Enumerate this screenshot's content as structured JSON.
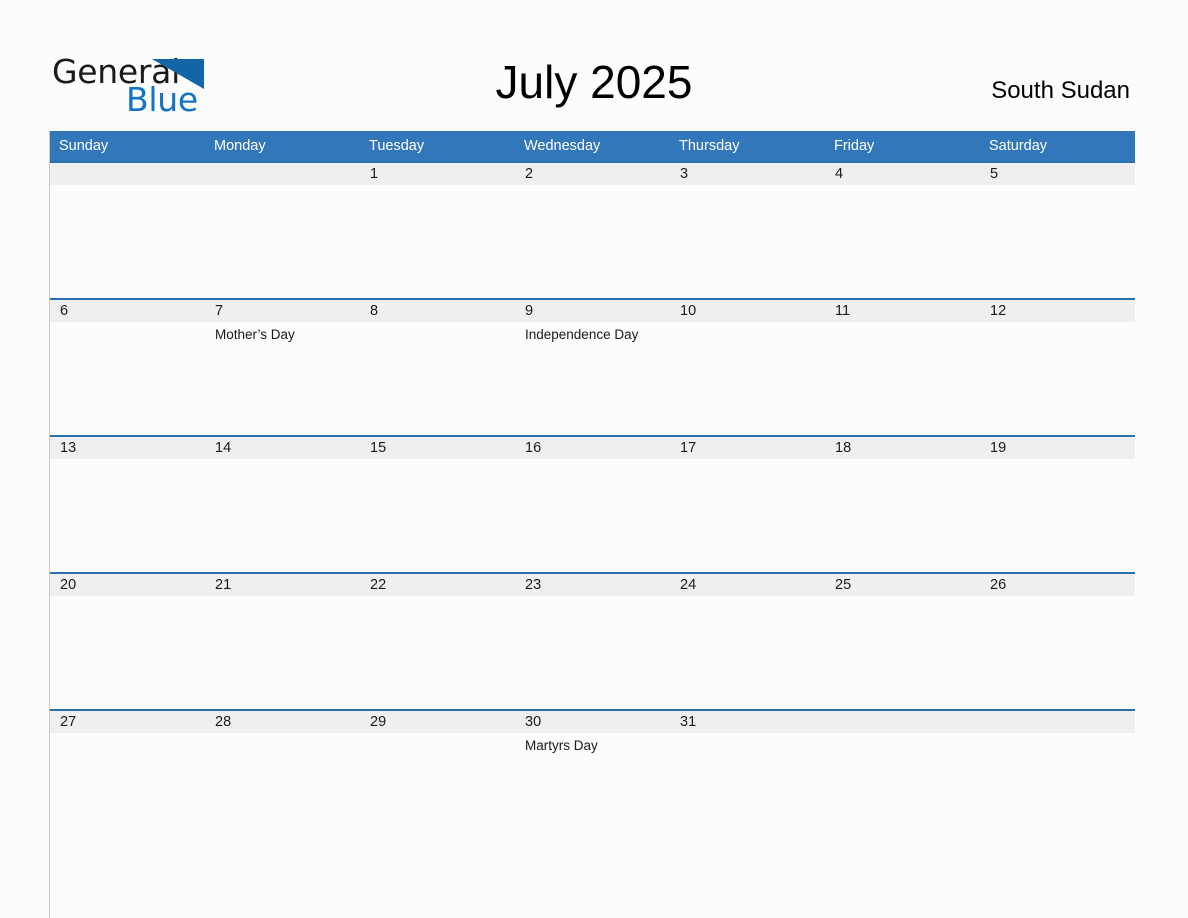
{
  "brand": {
    "name_part1": "General",
    "name_part2": "Blue",
    "triangle_icon": "brand-triangle-icon",
    "color_black": "#1A1A1A",
    "color_blue": "#1473C4"
  },
  "header": {
    "title": "July 2025",
    "country": "South Sudan"
  },
  "colors": {
    "header_blue": "#3177B9",
    "row_separator_blue": "#2C6FAF",
    "daynum_band": "#EFEFEF",
    "cell_background": "#FCFCFC"
  },
  "weekdays": [
    "Sunday",
    "Monday",
    "Tuesday",
    "Wednesday",
    "Thursday",
    "Friday",
    "Saturday"
  ],
  "weeks": [
    {
      "days": [
        {
          "num": "",
          "events": []
        },
        {
          "num": "",
          "events": []
        },
        {
          "num": "1",
          "events": []
        },
        {
          "num": "2",
          "events": []
        },
        {
          "num": "3",
          "events": []
        },
        {
          "num": "4",
          "events": []
        },
        {
          "num": "5",
          "events": []
        }
      ]
    },
    {
      "days": [
        {
          "num": "6",
          "events": []
        },
        {
          "num": "7",
          "events": [
            "Mother’s Day"
          ]
        },
        {
          "num": "8",
          "events": []
        },
        {
          "num": "9",
          "events": [
            "Independence Day"
          ]
        },
        {
          "num": "10",
          "events": []
        },
        {
          "num": "11",
          "events": []
        },
        {
          "num": "12",
          "events": []
        }
      ]
    },
    {
      "days": [
        {
          "num": "13",
          "events": []
        },
        {
          "num": "14",
          "events": []
        },
        {
          "num": "15",
          "events": []
        },
        {
          "num": "16",
          "events": []
        },
        {
          "num": "17",
          "events": []
        },
        {
          "num": "18",
          "events": []
        },
        {
          "num": "19",
          "events": []
        }
      ]
    },
    {
      "days": [
        {
          "num": "20",
          "events": []
        },
        {
          "num": "21",
          "events": []
        },
        {
          "num": "22",
          "events": []
        },
        {
          "num": "23",
          "events": []
        },
        {
          "num": "24",
          "events": []
        },
        {
          "num": "25",
          "events": []
        },
        {
          "num": "26",
          "events": []
        }
      ]
    },
    {
      "days": [
        {
          "num": "27",
          "events": []
        },
        {
          "num": "28",
          "events": []
        },
        {
          "num": "29",
          "events": []
        },
        {
          "num": "30",
          "events": [
            "Martyrs Day"
          ]
        },
        {
          "num": "31",
          "events": []
        },
        {
          "num": "",
          "events": []
        },
        {
          "num": "",
          "events": []
        }
      ]
    }
  ]
}
